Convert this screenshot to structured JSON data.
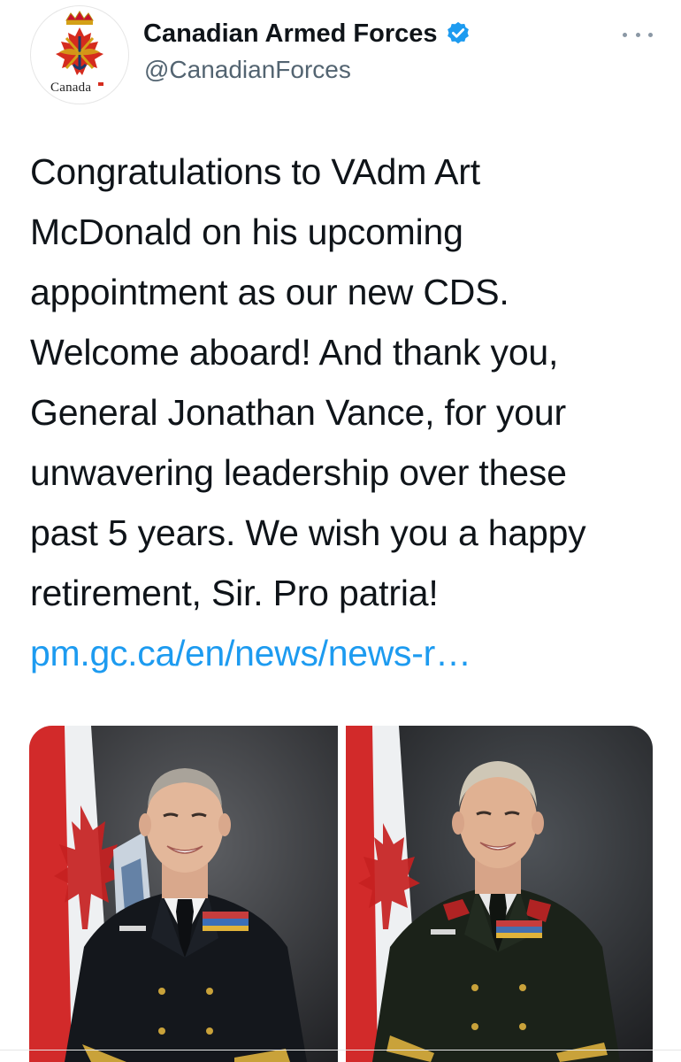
{
  "account": {
    "display_name": "Canadian Armed Forces",
    "handle": "@CanadianForces",
    "verified": true,
    "avatar_icon": "canadian-forces-badge-icon",
    "avatar_wordmark": "Canada"
  },
  "tweet": {
    "text": "Congratulations to VAdm Art\nMcDonald on his upcoming\nappointment as our new CDS.\nWelcome aboard! And thank you,\nGeneral Jonathan Vance, for your\nunwavering leadership over these\npast 5 years. We wish you a happy\nretirement, Sir. Pro patria!",
    "link_text": "pm.gc.ca/en/news/news-r…"
  },
  "icons": {
    "more": "more-horizontal-icon",
    "verified": "verified-badge-icon"
  },
  "media": [
    {
      "name": "photo-vadm-mcdonald",
      "uniform": "naval-dark"
    },
    {
      "name": "photo-gen-vance",
      "uniform": "army-dark-green"
    }
  ],
  "colors": {
    "link": "#1d9bf0",
    "verified": "#1d9bf0",
    "text": "#0f1419",
    "secondary": "#536471"
  }
}
